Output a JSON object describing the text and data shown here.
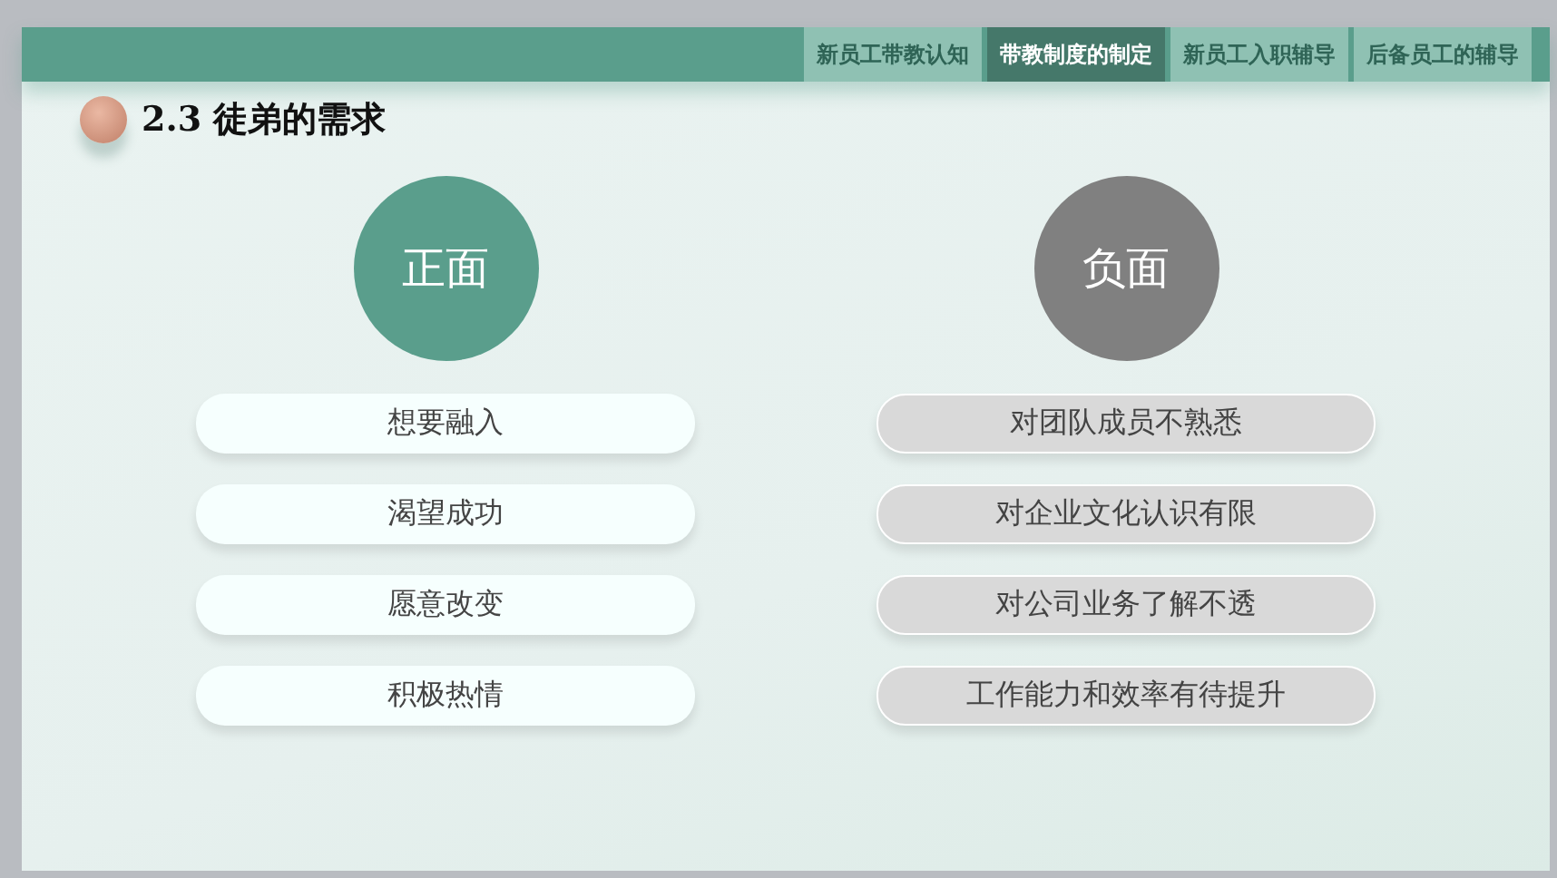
{
  "tabs": [
    {
      "label": "新员工带教认知",
      "selected": false
    },
    {
      "label": "带教制度的制定",
      "selected": true
    },
    {
      "label": "新员工入职辅导",
      "selected": false
    },
    {
      "label": "后备员工的辅导",
      "selected": false
    }
  ],
  "title": "2.3 徒弟的需求",
  "columns": [
    {
      "kind": "positive",
      "heading": "正面",
      "items": [
        "想要融入",
        "渴望成功",
        "愿意改变",
        "积极热情"
      ]
    },
    {
      "kind": "negative",
      "heading": "负面",
      "items": [
        "对团队成员不熟悉",
        "对企业文化认识有限",
        "对公司业务了解不透",
        "工作能力和效率有待提升"
      ]
    }
  ]
}
